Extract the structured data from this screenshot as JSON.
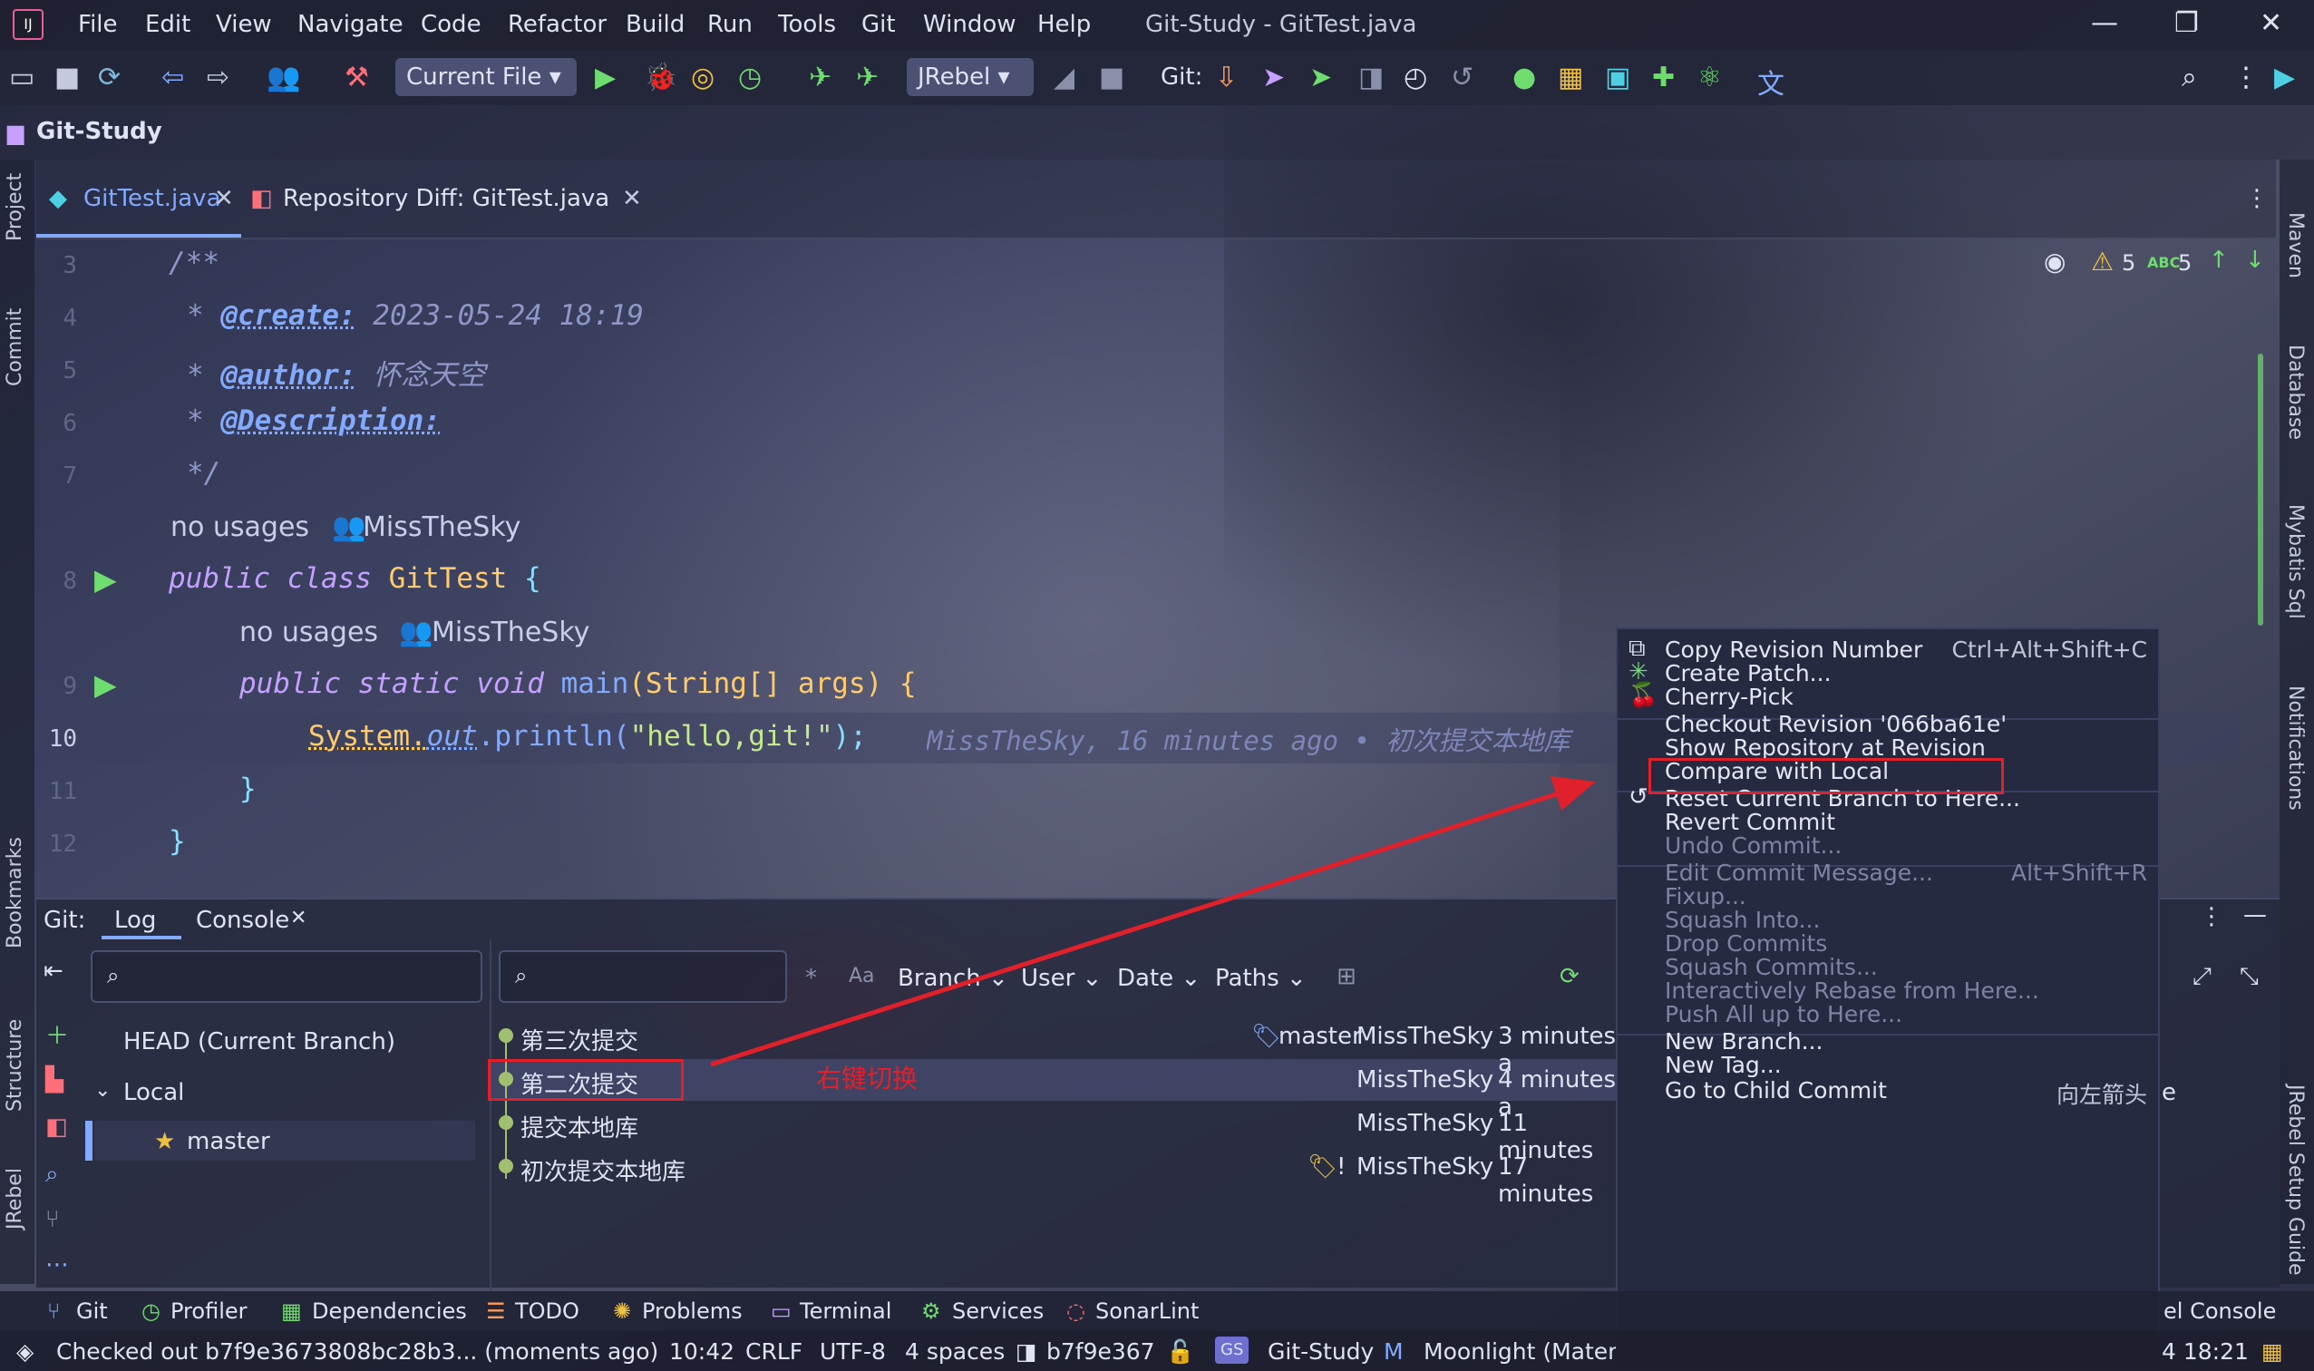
{
  "menubar": {
    "items": [
      "File",
      "Edit",
      "View",
      "Navigate",
      "Code",
      "Refactor",
      "Build",
      "Run",
      "Tools",
      "Git",
      "Window",
      "Help"
    ],
    "window_title": "Git-Study - GitTest.java"
  },
  "toolbar": {
    "run_config": "Current File",
    "jrebel": "JRebel",
    "git_label": "Git:"
  },
  "project": {
    "name": "Git-Study"
  },
  "tabs": [
    {
      "label": "GitTest.java",
      "active": true
    },
    {
      "label": "Repository Diff: GitTest.java",
      "active": false
    }
  ],
  "inspections": {
    "warnings": "5",
    "typos": "5"
  },
  "editor": {
    "line_numbers": [
      "3",
      "4",
      "5",
      "6",
      "7",
      "8",
      "9",
      "10",
      "11",
      "12"
    ],
    "lines": {
      "l3": "/**",
      "l4_star": "* ",
      "l4_tag": "@create:",
      "l4_val": " 2023-05-24 18:19",
      "l5_star": "* ",
      "l5_tag": "@author:",
      "l5_val": " 怀念天空",
      "l6_star": "* ",
      "l6_tag": "@Description:",
      "l7": "*/",
      "usages1": "no usages",
      "author1": "MissTheSky",
      "l8_kw": "public class ",
      "l8_name": "GitTest",
      "l8_rest": " {",
      "usages2": "no usages",
      "author2": "MissTheSky",
      "l9_kw": "public static void ",
      "l9_name": "main",
      "l9_rest": "(String[] args) {",
      "l10_a": "System.",
      "l10_b": "out",
      "l10_c": ".println(",
      "l10_str": "\"hello,git!\"",
      "l10_d": ");",
      "l10_blame": "MissTheSky, 16 minutes ago • 初次提交本地库",
      "l11": "}",
      "l12": "}"
    }
  },
  "left_tools": [
    "Project",
    "Commit",
    "Bookmarks",
    "Structure",
    "JRebel"
  ],
  "right_tools": [
    "Maven",
    "Database",
    "Mybatis Sql",
    "Notifications",
    "JRebel Setup Guide"
  ],
  "git_panel": {
    "label": "Git:",
    "tabs": [
      "Log",
      "Console"
    ],
    "filters": [
      "Branch",
      "User",
      "Date",
      "Paths"
    ],
    "match_case": "Aa",
    "branches": {
      "head": "HEAD (Current Branch)",
      "local": "Local",
      "master": "master"
    },
    "commits": [
      {
        "msg": "第三次提交",
        "ref": "master",
        "author": "MissTheSky",
        "time": "3 minutes a"
      },
      {
        "msg": "第二次提交",
        "ref": "",
        "author": "MissTheSky",
        "time": "4 minutes a"
      },
      {
        "msg": "提交本地库",
        "ref": "",
        "author": "MissTheSky",
        "time": "11 minutes"
      },
      {
        "msg": "初次提交本地库",
        "ref": "!",
        "author": "MissTheSky",
        "time": "17 minutes"
      }
    ],
    "annotation": "右键切换",
    "right_clip": "e"
  },
  "context_menu": {
    "items": [
      {
        "label": "Copy Revision Number",
        "shortcut": "Ctrl+Alt+Shift+C",
        "disabled": false
      },
      {
        "label": "Create Patch...",
        "shortcut": "",
        "disabled": false
      },
      {
        "label": "Cherry-Pick",
        "shortcut": "",
        "disabled": false
      },
      {
        "label": "Checkout Revision '066ba61e'",
        "shortcut": "",
        "disabled": false
      },
      {
        "label": "Show Repository at Revision",
        "shortcut": "",
        "disabled": false
      },
      {
        "label": "Compare with Local",
        "shortcut": "",
        "disabled": false
      },
      {
        "label": "Reset Current Branch to Here...",
        "shortcut": "",
        "disabled": false
      },
      {
        "label": "Revert Commit",
        "shortcut": "",
        "disabled": false
      },
      {
        "label": "Undo Commit...",
        "shortcut": "",
        "disabled": true
      },
      {
        "label": "Edit Commit Message...",
        "shortcut": "Alt+Shift+R",
        "disabled": true
      },
      {
        "label": "Fixup...",
        "shortcut": "",
        "disabled": true
      },
      {
        "label": "Squash Into...",
        "shortcut": "",
        "disabled": true
      },
      {
        "label": "Drop Commits",
        "shortcut": "",
        "disabled": true
      },
      {
        "label": "Squash Commits...",
        "shortcut": "",
        "disabled": true
      },
      {
        "label": "Interactively Rebase from Here...",
        "shortcut": "",
        "disabled": true
      },
      {
        "label": "Push All up to Here...",
        "shortcut": "",
        "disabled": true
      },
      {
        "label": "New Branch...",
        "shortcut": "",
        "disabled": false
      },
      {
        "label": "New Tag...",
        "shortcut": "",
        "disabled": false
      },
      {
        "label": "Go to Child Commit",
        "shortcut": "向左箭头",
        "disabled": false
      }
    ]
  },
  "tool_strip": [
    "Git",
    "Profiler",
    "Dependencies",
    "TODO",
    "Problems",
    "Terminal",
    "Services",
    "SonarLint",
    "el Console"
  ],
  "status_bar": {
    "message": "Checked out b7f9e3673808bc28b3... (moments ago)",
    "position": "10:42",
    "line_sep": "CRLF",
    "encoding": "UTF-8",
    "indent": "4 spaces",
    "revision": "b7f9e367",
    "gs": "GS",
    "project": "Git-Study",
    "theme": "Moonlight (Materi",
    "time": "4 18:21"
  },
  "colors": {
    "accent": "#82aaff",
    "annotation_red": "#e0202a",
    "selection": "#50568a"
  }
}
